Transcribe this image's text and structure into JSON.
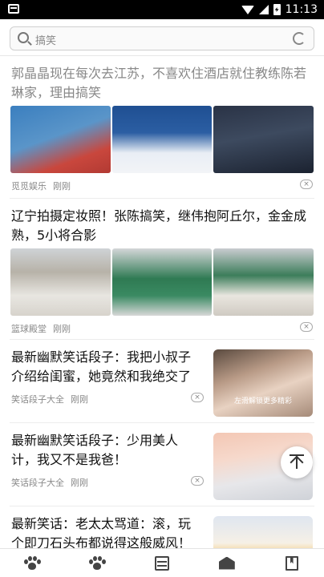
{
  "status_bar": {
    "time": "11:13"
  },
  "search": {
    "placeholder": "搞笑"
  },
  "feed": [
    {
      "title": "郭晶晶现在每次去江苏，不喜欢住酒店就住教练陈若琳家，理由搞笑",
      "source": "觅觅娱乐",
      "time": "刚刚",
      "layout": "three-images",
      "read": true
    },
    {
      "title": "辽宁拍摄定妆照！张陈搞笑，继伟抱阿丘尔，金金成熟，5小将合影",
      "source": "篮球殿堂",
      "time": "刚刚",
      "layout": "three-images",
      "read": false
    },
    {
      "title": "最新幽默笑话段子：我把小叔子介绍给闺蜜，她竟然和我绝交了",
      "source": "笑话段子大全",
      "time": "刚刚",
      "layout": "right-thumb",
      "thumb_caption": "左滑解锁更多精彩",
      "read": false
    },
    {
      "title": "最新幽默笑话段子：少用美人计，我又不是我爸！",
      "source": "笑话段子大全",
      "time": "刚刚",
      "layout": "right-thumb",
      "read": false
    },
    {
      "title": "最新笑话：老太太骂道：滚，玩个即刀石头布都说得这般威风！",
      "layout": "right-thumb",
      "read": false
    }
  ],
  "tabbar": {
    "tabs": [
      {
        "icon": "paw-icon"
      },
      {
        "icon": "paw-icon"
      },
      {
        "icon": "menu-icon"
      },
      {
        "icon": "inbox-icon"
      },
      {
        "icon": "bookmark-icon"
      }
    ]
  },
  "colors": {
    "text": "#111111",
    "read_text": "#888888",
    "divider": "#ececec"
  }
}
